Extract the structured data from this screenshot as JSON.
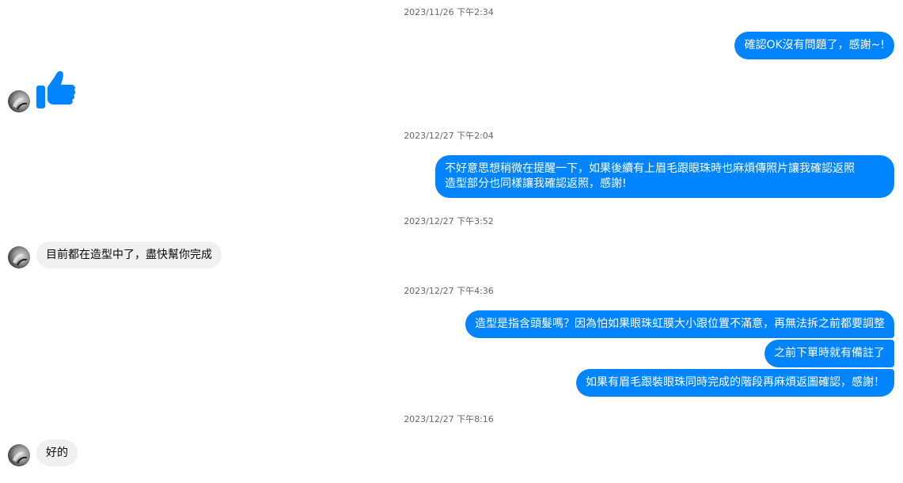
{
  "colors": {
    "outgoing_bubble": "#0084ff",
    "incoming_bubble": "#f0f0f0",
    "timestamp_text": "#65676b",
    "like_icon": "#0084ff"
  },
  "messages": [
    {
      "type": "timestamp",
      "text": "2023/11/26 下午2:34"
    },
    {
      "type": "outgoing",
      "text": "確認OK沒有問題了，感謝~!"
    },
    {
      "type": "incoming-like",
      "icon": "thumbs-up-icon"
    },
    {
      "type": "timestamp",
      "text": "2023/12/27 下午2:04"
    },
    {
      "type": "outgoing",
      "lines": [
        "不好意思想稍微在提醒一下，如果後續有上眉毛跟眼珠時也麻煩傳照片讓我確認返照",
        "造型部分也同樣讓我確認返照，感謝!"
      ]
    },
    {
      "type": "timestamp",
      "text": "2023/12/27 下午3:52"
    },
    {
      "type": "incoming",
      "text": "目前都在造型中了，盡快幫你完成"
    },
    {
      "type": "timestamp",
      "text": "2023/12/27 下午4:36"
    },
    {
      "type": "outgoing",
      "text": "造型是指含頭髮嗎？因為怕如果眼珠虹膜大小跟位置不滿意，再無法拆之前都要調整"
    },
    {
      "type": "outgoing",
      "text": "之前下單時就有備註了"
    },
    {
      "type": "outgoing",
      "text": "如果有眉毛跟裝眼珠同時完成的階段再麻煩返圖確認，感謝！"
    },
    {
      "type": "timestamp",
      "text": "2023/12/27 下午8:16"
    },
    {
      "type": "incoming",
      "text": "好的"
    }
  ]
}
